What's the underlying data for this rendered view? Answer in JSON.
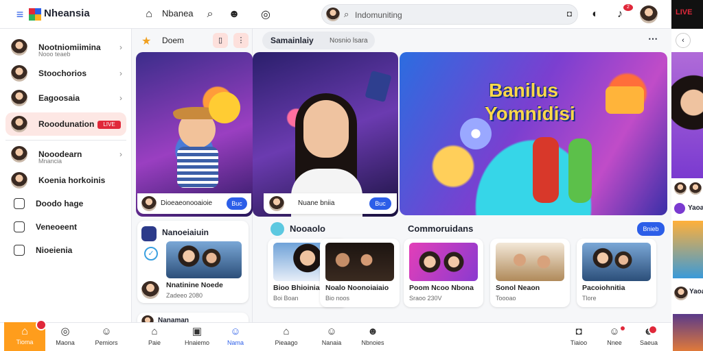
{
  "topbar": {
    "app_title": "Nheansia",
    "nav_label": "Nbanea",
    "search_placeholder": "Indomuniting",
    "notif_count": "2"
  },
  "sidebar": {
    "items": [
      {
        "label": "Nootniomiimina",
        "sub": "Nooo teaeb"
      },
      {
        "label": "Stoochorios",
        "sub": ""
      },
      {
        "label": "Eagoosaia",
        "sub": ""
      },
      {
        "label": "Rooodunation",
        "sub": "",
        "badge": "LIVE"
      },
      {
        "label": "Nooodearn",
        "sub": "Mnancia"
      },
      {
        "label": "Koenia horkoinis",
        "sub": ""
      },
      {
        "label": "Doodo hage",
        "sub": ""
      },
      {
        "label": "Veneoeent",
        "sub": ""
      },
      {
        "label": "Nioeienia",
        "sub": ""
      }
    ]
  },
  "bottomnav_left": [
    {
      "label": "Tioma"
    },
    {
      "label": "Maona"
    },
    {
      "label": "Pemiors"
    }
  ],
  "col2": {
    "head_label": "Doem",
    "hero_caption": "Dioeaeonooaioie",
    "hero_btn": "Buc",
    "section_title": "Nanoeiaiuin",
    "card_title": "Nnatinine Noede",
    "card_meta": "Zadeeo 2080",
    "bottom_title": "Nanaman"
  },
  "bottomnav_mid": [
    {
      "label": "Paie"
    },
    {
      "label": "Hnaiemo"
    },
    {
      "label": "Nama"
    }
  ],
  "main": {
    "chip_label": "Samainlaiy",
    "chip_sub": "Nosnio lsara",
    "hero2_caption": "Nuane bniia",
    "hero2_btn": "Buc",
    "banner_title_line1": "Banilus",
    "banner_title_line2": "Yomnidisi",
    "sec_left": "Nooaolo",
    "sec_right": "Commoruidans",
    "sec_btn": "Bnieb",
    "tiles": [
      {
        "t1": "Bioo Bhioinia",
        "t2": "Boi Boan"
      },
      {
        "t1": "Noalo Noonoiaiaio",
        "t2": "Bio noos"
      },
      {
        "t1": "Poom Ncoo Nbona",
        "t2": "Sraoo 230V"
      },
      {
        "t1": "Sonol Neaon",
        "t2": "Toooao"
      },
      {
        "t1": "Pacoiohnitia",
        "t2": "Tlore"
      }
    ]
  },
  "bottomnav_right": [
    {
      "label": "Pieaago"
    },
    {
      "label": "Nanaia"
    },
    {
      "label": "Nbnoies"
    },
    {
      "label": "Tiaioo"
    },
    {
      "label": "Nnee"
    },
    {
      "label": "Saeua"
    }
  ],
  "right_strip": {
    "title": "LIVE",
    "label1": "Yaoa",
    "label2": "Yaoa"
  },
  "colors": {
    "accent": "#2c5ee8",
    "home": "#ff9d1c",
    "alert": "#e0283a"
  }
}
